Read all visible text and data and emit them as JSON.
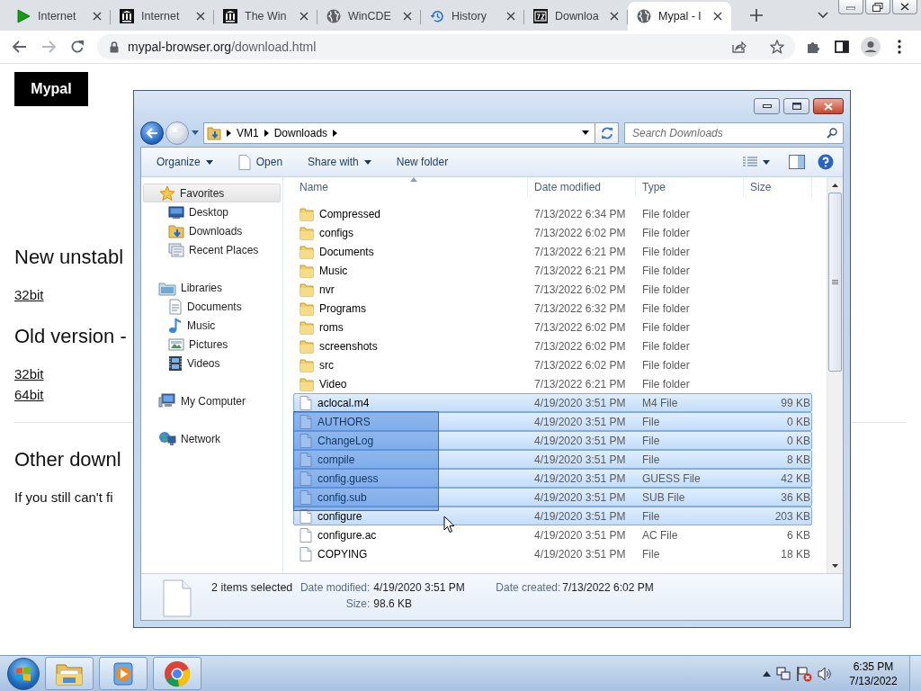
{
  "browser": {
    "tabs": [
      {
        "title": "Internet",
        "kind": "play",
        "selected": false
      },
      {
        "title": "Internet",
        "kind": "columns",
        "selected": false
      },
      {
        "title": "The Win",
        "kind": "columns",
        "selected": false
      },
      {
        "title": "WinCDE",
        "kind": "globe",
        "selected": false
      },
      {
        "title": "History",
        "kind": "history",
        "selected": false
      },
      {
        "title": "Downloa",
        "kind": "archive",
        "selected": false
      },
      {
        "title": "Mypal - l",
        "kind": "globe",
        "selected": true
      }
    ],
    "address": {
      "host": "mypal-browser.org",
      "path": "/download.html"
    }
  },
  "page": {
    "logo": "Mypal",
    "sections": [
      {
        "kind": "heading",
        "text": "New unstabl"
      },
      {
        "kind": "link",
        "text": "32bit"
      },
      {
        "kind": "heading",
        "text": "Old version -"
      },
      {
        "kind": "link",
        "text": "32bit"
      },
      {
        "kind": "link",
        "text": "64bit"
      },
      {
        "kind": "rule"
      },
      {
        "kind": "heading",
        "text": "Other downl"
      },
      {
        "kind": "paragraph",
        "text": "If you still can't fi"
      }
    ]
  },
  "explorer": {
    "breadcrumb": [
      "VM1",
      "Downloads"
    ],
    "search": {
      "placeholder": "Search Downloads"
    },
    "toolbar": [
      {
        "label": "Organize",
        "kind": "menu"
      },
      {
        "label": "Open",
        "kind": "open"
      },
      {
        "label": "Share with",
        "kind": "menu"
      },
      {
        "label": "New folder",
        "kind": "plain"
      }
    ],
    "nav": [
      {
        "label": "Favorites",
        "kind": "star",
        "selected": true,
        "children": [
          {
            "label": "Desktop",
            "kind": "desktop",
            "selected": false
          },
          {
            "label": "Downloads",
            "kind": "downloads",
            "selected": false
          },
          {
            "label": "Recent Places",
            "kind": "recent",
            "selected": false
          }
        ]
      },
      {
        "label": "Libraries",
        "kind": "libraries",
        "selected": false,
        "children": [
          {
            "label": "Documents",
            "kind": "documents",
            "selected": false
          },
          {
            "label": "Music",
            "kind": "music",
            "selected": false
          },
          {
            "label": "Pictures",
            "kind": "pictures",
            "selected": false
          },
          {
            "label": "Videos",
            "kind": "videos",
            "selected": false
          }
        ]
      },
      {
        "label": "My Computer",
        "kind": "computer",
        "selected": false
      },
      {
        "label": "Network",
        "kind": "network",
        "selected": false
      }
    ],
    "columns": [
      "Name",
      "Date modified",
      "Type",
      "Size"
    ],
    "files": [
      {
        "name": "Compressed",
        "date": "7/13/2022 6:34 PM",
        "type": "File folder",
        "kind": "folder",
        "selected": false
      },
      {
        "name": "configs",
        "date": "7/13/2022 6:02 PM",
        "type": "File folder",
        "kind": "folder",
        "selected": false
      },
      {
        "name": "Documents",
        "date": "7/13/2022 6:21 PM",
        "type": "File folder",
        "kind": "folder",
        "selected": false
      },
      {
        "name": "Music",
        "date": "7/13/2022 6:21 PM",
        "type": "File folder",
        "kind": "folder",
        "selected": false
      },
      {
        "name": "nvr",
        "date": "7/13/2022 6:02 PM",
        "type": "File folder",
        "kind": "folder",
        "selected": false
      },
      {
        "name": "Programs",
        "date": "7/13/2022 6:32 PM",
        "type": "File folder",
        "kind": "folder",
        "selected": false
      },
      {
        "name": "roms",
        "date": "7/13/2022 6:02 PM",
        "type": "File folder",
        "kind": "folder",
        "selected": false
      },
      {
        "name": "screenshots",
        "date": "7/13/2022 6:02 PM",
        "type": "File folder",
        "kind": "folder",
        "selected": false
      },
      {
        "name": "src",
        "date": "7/13/2022 6:02 PM",
        "type": "File folder",
        "kind": "folder",
        "selected": false
      },
      {
        "name": "Video",
        "date": "7/13/2022 6:21 PM",
        "type": "File folder",
        "kind": "folder",
        "selected": false
      },
      {
        "name": "aclocal.m4",
        "date": "4/19/2020 3:51 PM",
        "type": "M4 File",
        "size": "99 KB",
        "kind": "file",
        "selected": true
      },
      {
        "name": "AUTHORS",
        "date": "4/19/2020 3:51 PM",
        "type": "File",
        "size": "0 KB",
        "kind": "file",
        "selected": true
      },
      {
        "name": "ChangeLog",
        "date": "4/19/2020 3:51 PM",
        "type": "File",
        "size": "0 KB",
        "kind": "file",
        "selected": true
      },
      {
        "name": "compile",
        "date": "4/19/2020 3:51 PM",
        "type": "File",
        "size": "8 KB",
        "kind": "file",
        "selected": true
      },
      {
        "name": "config.guess",
        "date": "4/19/2020 3:51 PM",
        "type": "GUESS File",
        "size": "42 KB",
        "kind": "file",
        "selected": true
      },
      {
        "name": "config.sub",
        "date": "4/19/2020 3:51 PM",
        "type": "SUB File",
        "size": "36 KB",
        "kind": "file",
        "selected": true
      },
      {
        "name": "configure",
        "date": "4/19/2020 3:51 PM",
        "type": "File",
        "size": "203 KB",
        "kind": "file",
        "selected": true
      },
      {
        "name": "configure.ac",
        "date": "4/19/2020 3:51 PM",
        "type": "AC File",
        "size": "6 KB",
        "kind": "file",
        "selected": false
      },
      {
        "name": "COPYING",
        "date": "4/19/2020 3:51 PM",
        "type": "File",
        "size": "18 KB",
        "kind": "file",
        "selected": false
      }
    ],
    "details": {
      "summary": "2 items selected",
      "fields": [
        {
          "label": "Date modified:",
          "value": "4/19/2020 3:51 PM"
        },
        {
          "label": "Date created:",
          "value": "7/13/2022 6:02 PM"
        },
        {
          "label": "Size:",
          "value": "98.6 KB"
        }
      ]
    }
  },
  "taskbar": {
    "apps": [
      {
        "kind": "folder"
      },
      {
        "kind": "media"
      },
      {
        "kind": "browser"
      }
    ],
    "clock": {
      "time": "6:35 PM",
      "date": "7/13/2022"
    }
  }
}
